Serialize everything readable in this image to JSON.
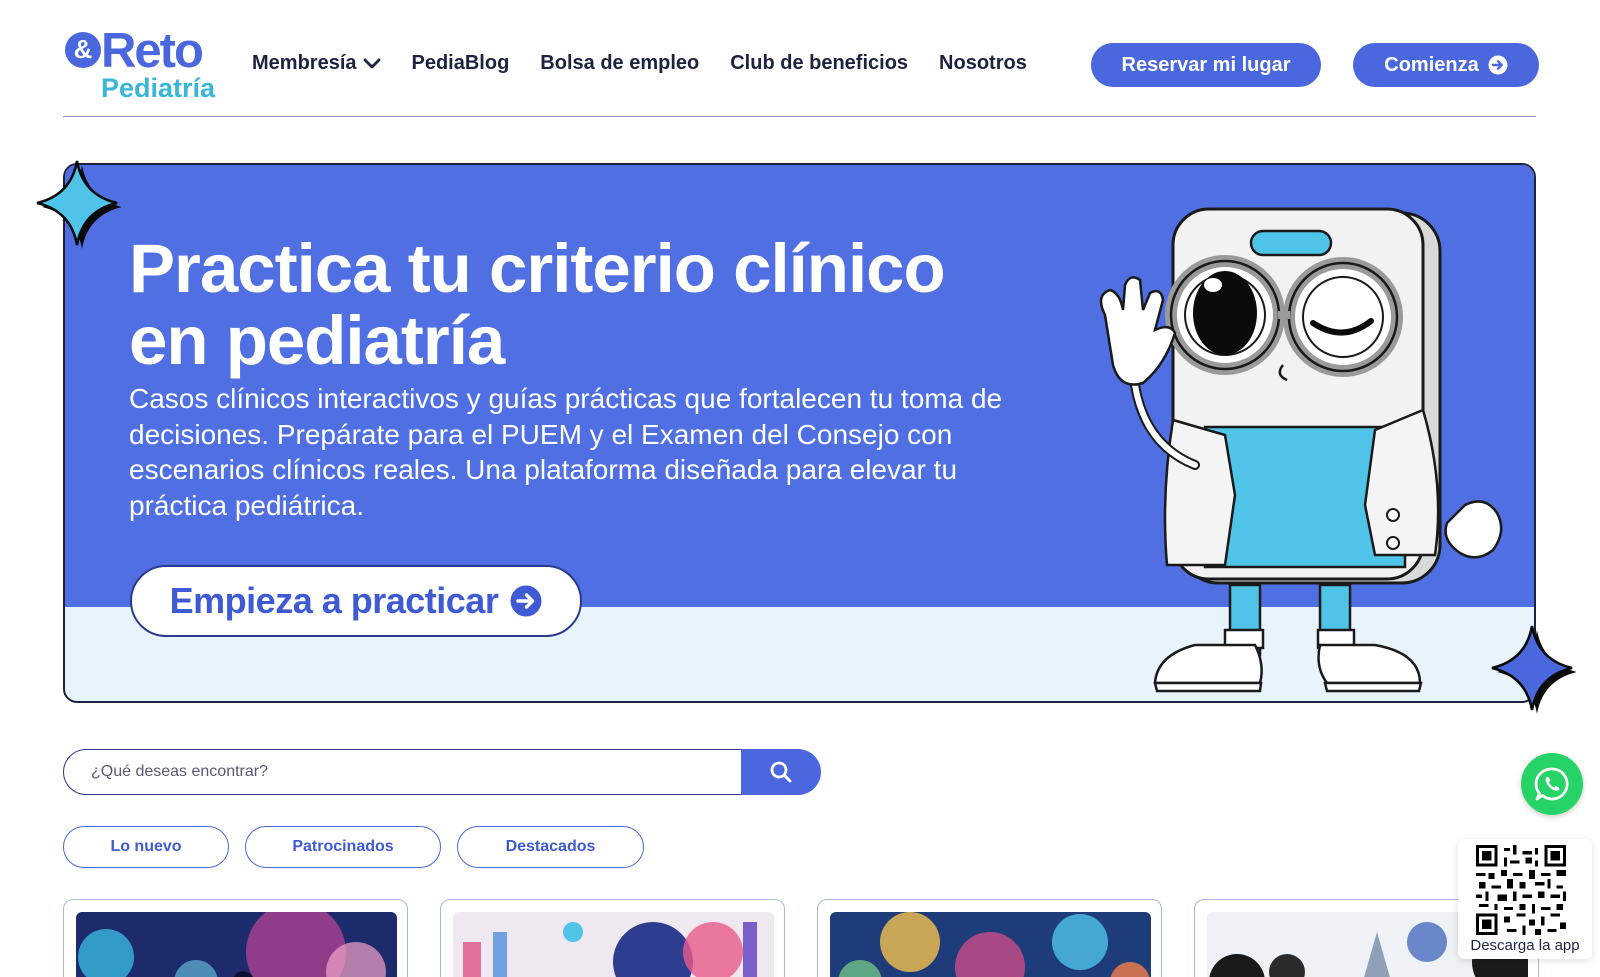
{
  "brand": {
    "logo_top": "Reto",
    "logo_bottom": "Pediatría",
    "primary_color": "#4b67dd",
    "accent_color": "#39b6d5",
    "hero_blue": "#4f6fe3"
  },
  "nav": {
    "items": [
      {
        "label": "Membresía",
        "icon": "chevron-down-icon"
      },
      {
        "label": "PediaBlog"
      },
      {
        "label": "Bolsa de empleo"
      },
      {
        "label": "Club de beneficios"
      },
      {
        "label": "Nosotros"
      }
    ],
    "reserve_label": "Reservar mi lugar",
    "start_label": "Comienza",
    "start_icon": "arrow-circle-right-icon"
  },
  "hero": {
    "title_line1": "Practica tu criterio clínico",
    "title_line2": "en pediatría",
    "subtitle_line1": "Casos clínicos interactivos y guías prácticas que fortalecen tu toma de",
    "subtitle_line2": "decisiones. Prepárate para el PUEM y el Examen del Consejo con",
    "subtitle_line3": "escenarios clínicos reales. Una plataforma diseñada para elevar tu",
    "subtitle_line4": "práctica pediátrica.",
    "cta_label": "Empieza a practicar",
    "cta_icon": "arrow-circle-right-icon",
    "illustration": "phone-mascot-with-magnifier-illustration"
  },
  "search": {
    "placeholder": "¿Qué deseas encontrar?",
    "value": "",
    "icon": "search-icon"
  },
  "filters": [
    {
      "label": "Lo nuevo"
    },
    {
      "label": "Patrocinados"
    },
    {
      "label": "Destacados"
    }
  ],
  "floating": {
    "whatsapp_icon": "whatsapp-icon",
    "qr_label": "Descarga la app"
  }
}
